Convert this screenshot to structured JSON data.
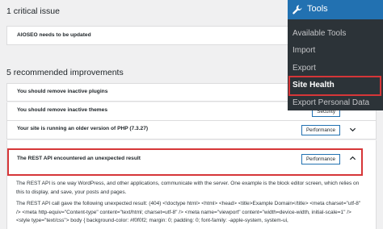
{
  "critical": {
    "title": "1 critical issue",
    "items": [
      {
        "label": "AIOSEO needs to be updated"
      }
    ]
  },
  "recommended": {
    "title": "5 recommended improvements",
    "items": [
      {
        "label": "You should remove inactive plugins",
        "badge": ""
      },
      {
        "label": "You should remove inactive themes",
        "badge": "Security"
      },
      {
        "label": "Your site is running an older version of PHP (7.3.27)",
        "badge": "Performance"
      },
      {
        "label": "The REST API encountered an unexpected result",
        "badge": "Performance"
      }
    ]
  },
  "expanded": {
    "paragraph1": "The REST API is one way WordPress, and other applications, communicate with the server. One example is the block editor screen, which relies on this to display, and save, your posts and pages.",
    "paragraph2": "The REST API call gave the following unexpected result: (404) <!doctype html> <html> <head> <title>Example Domain</title> <meta charset=\"utf-8\" /> <meta http-equiv=\"Content-type\" content=\"text/html; charset=utf-8\" /> <meta name=\"viewport\" content=\"width=device-width, initial-scale=1\" /> <style type=\"text/css\"> body { background-color: #f0f0f2; margin: 0; padding: 0; font-family: -apple-system, system-ui,"
  },
  "tools_menu": {
    "title": "Tools",
    "items": [
      "Available Tools",
      "Import",
      "Export",
      "Site Health",
      "Export Personal Data"
    ],
    "active": "Site Health"
  },
  "colors": {
    "accent": "#2271b1",
    "highlight": "#d63638",
    "menu_bg": "#2c3338"
  }
}
